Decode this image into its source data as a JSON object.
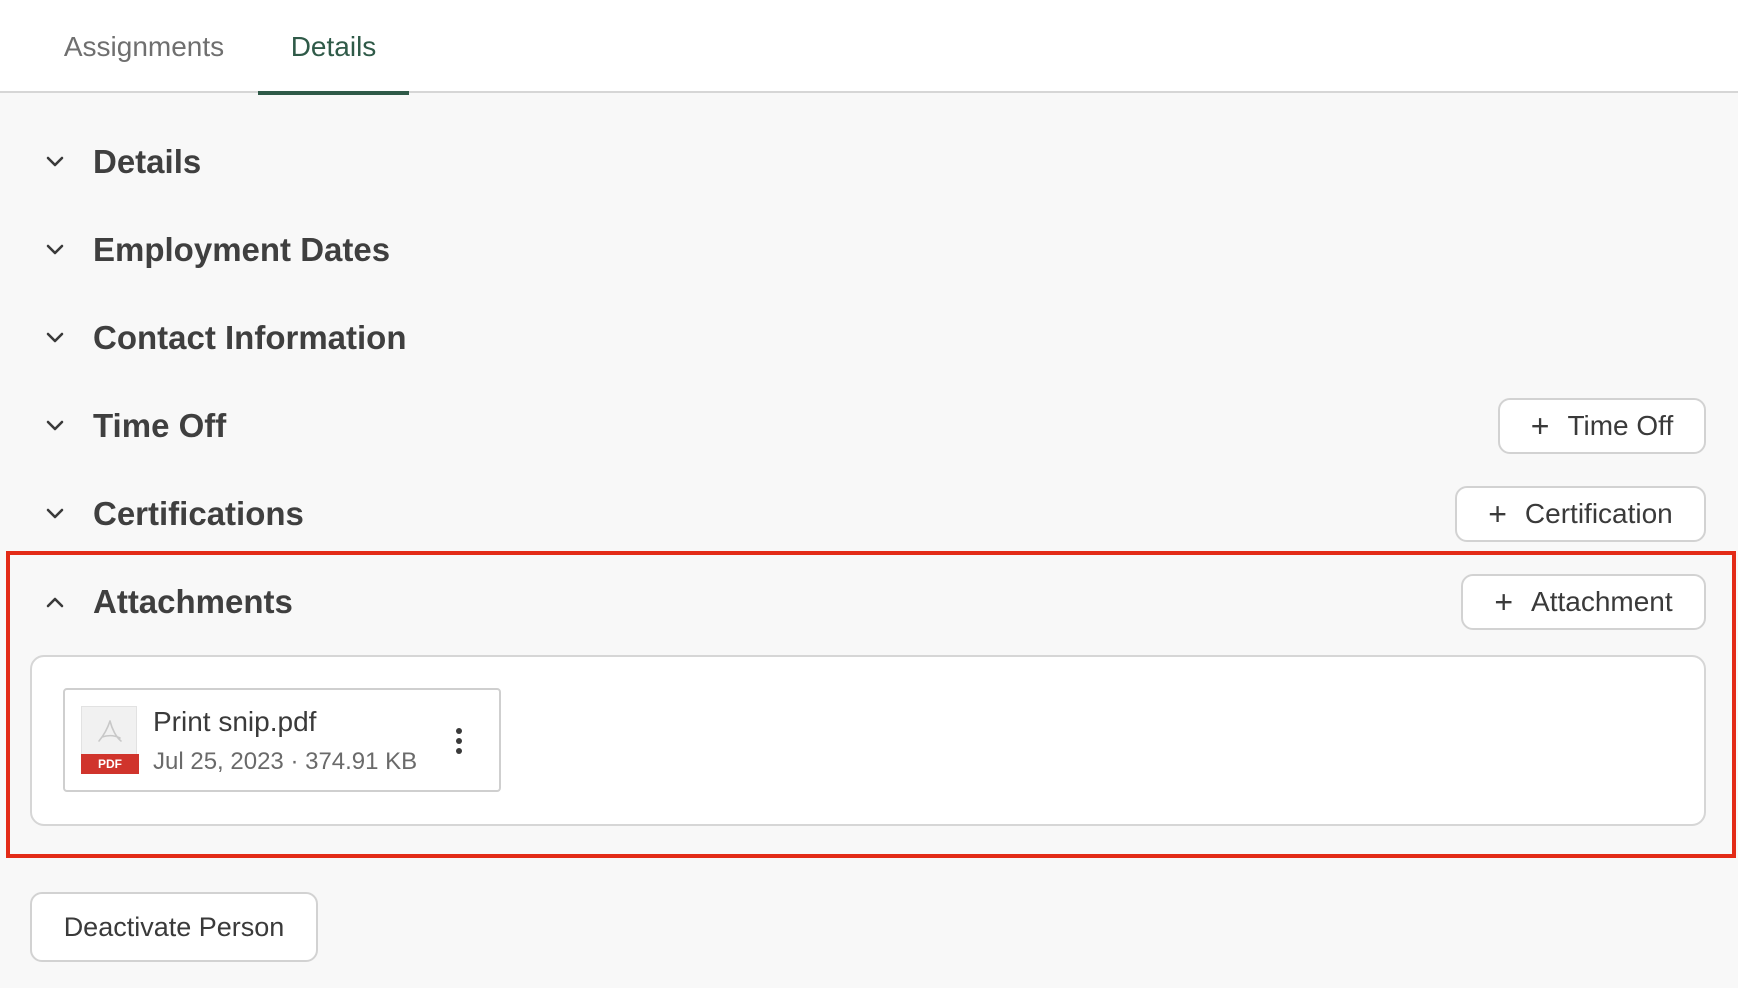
{
  "tabs": [
    {
      "label": "Assignments",
      "active": false
    },
    {
      "label": "Details",
      "active": true
    }
  ],
  "sections": [
    {
      "title": "Details",
      "expanded": false
    },
    {
      "title": "Employment Dates",
      "expanded": false
    },
    {
      "title": "Contact Information",
      "expanded": false
    },
    {
      "title": "Time Off",
      "expanded": false,
      "action_label": "Time Off"
    },
    {
      "title": "Certifications",
      "expanded": false,
      "action_label": "Certification"
    },
    {
      "title": "Attachments",
      "expanded": true,
      "action_label": "Attachment"
    }
  ],
  "attachments": [
    {
      "file_name": "Print snip.pdf",
      "meta": "Jul 25, 2023 · 374.91 KB",
      "type_badge": "PDF"
    }
  ],
  "footer": {
    "deactivate_label": "Deactivate Person"
  },
  "colors": {
    "accent": "#2f5a48",
    "highlight": "#e32b17",
    "pdf_badge": "#d0342c"
  }
}
